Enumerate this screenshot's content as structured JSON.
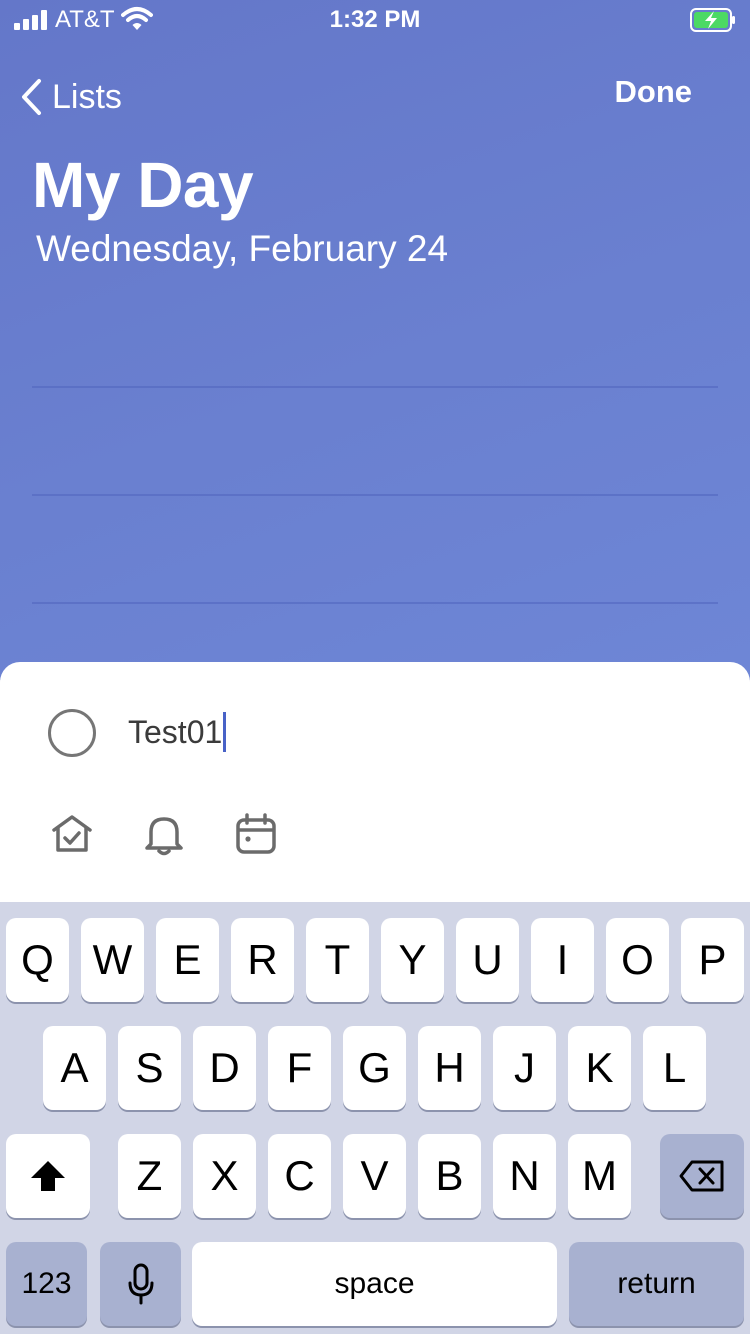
{
  "status_bar": {
    "carrier": "AT&T",
    "time": "1:32 PM",
    "icons": [
      "signal-bars-icon",
      "wifi-icon",
      "battery-charging-icon"
    ]
  },
  "nav": {
    "back_label": "Lists",
    "done_label": "Done"
  },
  "header": {
    "title": "My Day",
    "date": "Wednesday, February 24"
  },
  "add_task": {
    "input_value": "Test01",
    "actions": [
      "add-to-my-day-icon",
      "remind-me-icon",
      "due-date-icon"
    ]
  },
  "keyboard": {
    "row1": [
      "Q",
      "W",
      "E",
      "R",
      "T",
      "Y",
      "U",
      "I",
      "O",
      "P"
    ],
    "row2": [
      "A",
      "S",
      "D",
      "F",
      "G",
      "H",
      "J",
      "K",
      "L"
    ],
    "row3": [
      "Z",
      "X",
      "C",
      "V",
      "B",
      "N",
      "M"
    ],
    "numbers_label": "123",
    "space_label": "space",
    "return_label": "return"
  },
  "colors": {
    "header_gradient_start": "#6477c9",
    "header_gradient_end": "#6e86d6",
    "caret": "#4862c7",
    "battery_charge": "#4cd964",
    "keyboard_bg": "#d1d5e6",
    "special_key_bg": "#a8b1d0"
  }
}
